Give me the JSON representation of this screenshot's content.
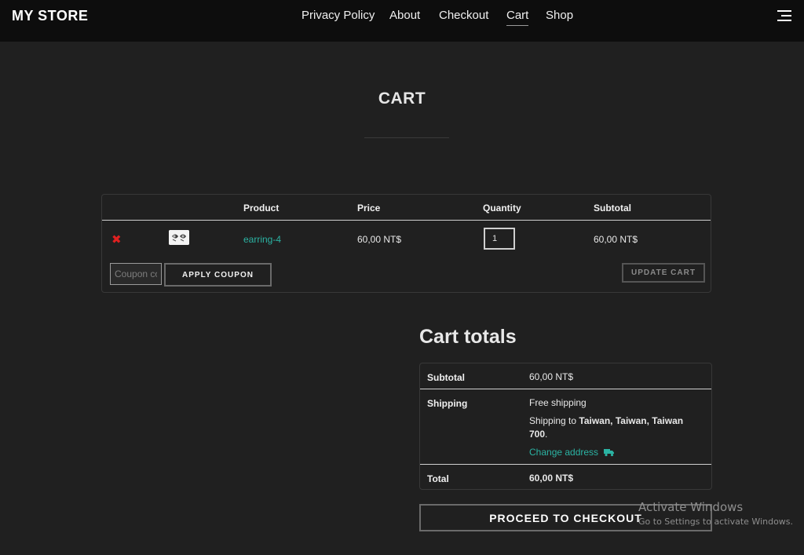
{
  "header": {
    "brand": "MY STORE",
    "nav": [
      {
        "label": "Privacy Policy",
        "active": false
      },
      {
        "label": "About",
        "active": false
      },
      {
        "label": "Checkout",
        "active": false
      },
      {
        "label": "Cart",
        "active": true
      },
      {
        "label": "Shop",
        "active": false
      }
    ],
    "menu_icon": "hamburger-icon"
  },
  "page": {
    "title": "CART"
  },
  "cart": {
    "columns": {
      "product": "Product",
      "price": "Price",
      "quantity": "Quantity",
      "subtotal": "Subtotal"
    },
    "items": [
      {
        "name": "earring-4",
        "price": "60,00 NT$",
        "quantity": "1",
        "subtotal": "60,00 NT$",
        "remove_symbol": "✖"
      }
    ],
    "coupon_placeholder": "Coupon code",
    "apply_coupon_label": "APPLY COUPON",
    "update_cart_label": "UPDATE CART"
  },
  "totals": {
    "heading": "Cart totals",
    "subtotal_label": "Subtotal",
    "subtotal_value": "60,00 NT$",
    "shipping_label": "Shipping",
    "shipping_method": "Free shipping",
    "shipping_to_prefix": "Shipping to ",
    "shipping_destination": "Taiwan, Taiwan, Taiwan 700",
    "shipping_to_suffix": ".",
    "change_address": "Change address",
    "total_label": "Total",
    "total_value": "60,00 NT$",
    "checkout_label": "PROCEED TO CHECKOUT"
  },
  "watermark": {
    "title": "Activate Windows",
    "subtitle": "Go to Settings to activate Windows."
  },
  "colors": {
    "background": "#202020",
    "header": "#0d0d0d",
    "accent": "#2bb3a3",
    "remove": "#e02020"
  }
}
